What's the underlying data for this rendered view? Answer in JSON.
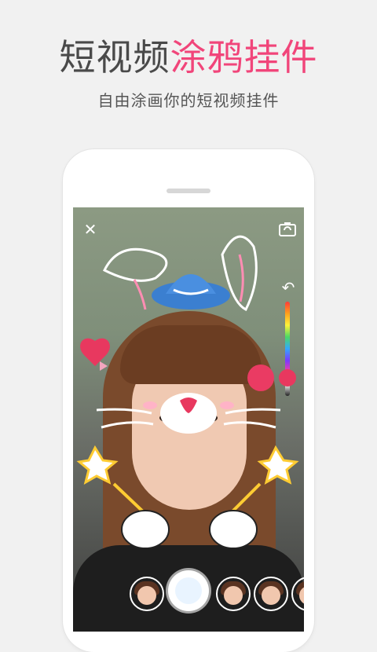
{
  "headline": {
    "gray_part": "短视频",
    "pink_part": "涂鸦挂件"
  },
  "subtitle": "自由涂画你的短视频挂件",
  "phone": {
    "screen": {
      "top_controls": {
        "close_icon": "close-icon",
        "camera_flip_icon": "camera-flip-icon",
        "undo_icon": "undo-icon"
      },
      "accent_colors": {
        "pink": "#f1457a",
        "blue_hat": "#3b7fd0",
        "selected_color": "#ea3b63"
      },
      "stickers": [
        {
          "name": "bunny-ears"
        },
        {
          "name": "blue-hat"
        },
        {
          "name": "cat-whiskers-face"
        },
        {
          "name": "heart"
        },
        {
          "name": "star-wands"
        }
      ],
      "sticker_bar": {
        "items": [
          "sticker-1",
          "sticker-2",
          "sticker-3",
          "sticker-4"
        ]
      }
    }
  }
}
